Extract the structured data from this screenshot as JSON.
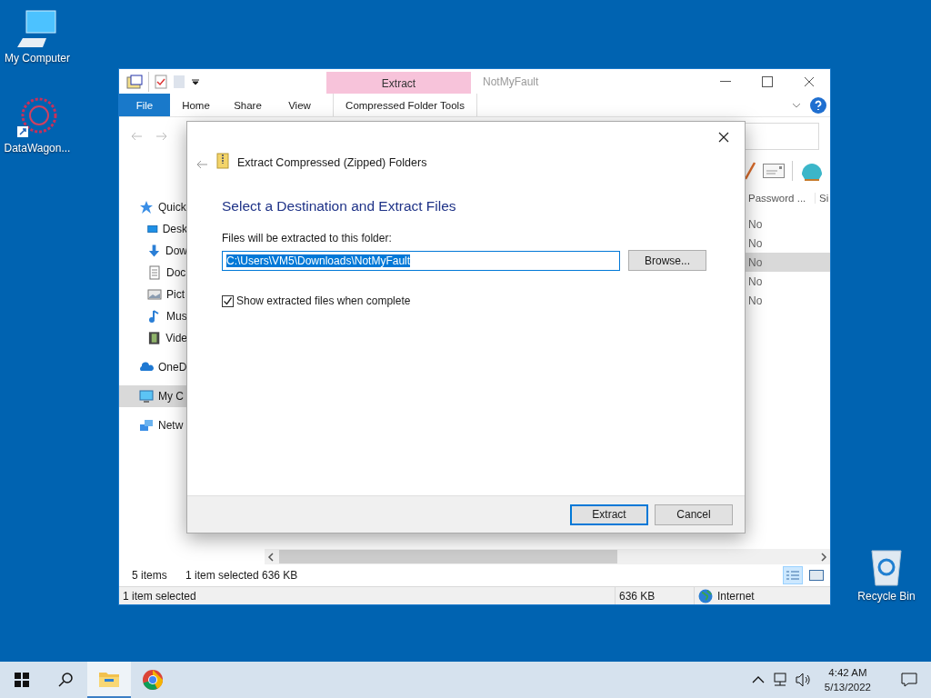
{
  "desktop_icons": [
    {
      "label": "My Computer",
      "kind": "computer"
    },
    {
      "label": "DataWagon...",
      "kind": "shortcut"
    },
    {
      "label": "Recycle Bin",
      "kind": "recycle"
    }
  ],
  "explorer": {
    "title": "NotMyFault",
    "context_tab": "Extract",
    "ribbon_tabs": [
      {
        "label": "File",
        "kind": "file"
      },
      {
        "label": "Home",
        "kind": "tab"
      },
      {
        "label": "Share",
        "kind": "tab"
      },
      {
        "label": "View",
        "kind": "tab"
      },
      {
        "label": "Compressed Folder Tools",
        "kind": "context"
      }
    ],
    "nav_pane": [
      {
        "label": "Quick",
        "kind": "star",
        "selected": false,
        "children": [
          {
            "label": "Desk",
            "kind": "desktop",
            "selected": false
          },
          {
            "label": "Dow",
            "kind": "download",
            "selected": false
          },
          {
            "label": "Doc",
            "kind": "document",
            "selected": false
          },
          {
            "label": "Pict",
            "kind": "pictures",
            "selected": false
          },
          {
            "label": "Mus",
            "kind": "music",
            "selected": false
          },
          {
            "label": "Vide",
            "kind": "video",
            "selected": false
          }
        ]
      },
      {
        "label": "OneD",
        "kind": "cloud",
        "selected": false
      },
      {
        "label": "My C",
        "kind": "computer",
        "selected": true
      },
      {
        "label": "Netw",
        "kind": "network",
        "selected": false
      }
    ],
    "columns": [
      "Password ...",
      "Si"
    ],
    "rows": [
      {
        "cells": [
          "No"
        ],
        "selected": false
      },
      {
        "cells": [
          "No"
        ],
        "selected": false
      },
      {
        "cells": [
          "No"
        ],
        "selected": true
      },
      {
        "cells": [
          "No"
        ],
        "selected": false
      },
      {
        "cells": [
          "No"
        ],
        "selected": false
      }
    ],
    "status": {
      "item_count": "5 items",
      "selection": "1 item selected",
      "size": "636 KB"
    },
    "status_bar": {
      "selection": "1 item selected",
      "size": "636 KB",
      "zone": "Internet"
    }
  },
  "dialog": {
    "title": "Extract Compressed (Zipped) Folders",
    "heading": "Select a Destination and Extract Files",
    "path_label": "Files will be extracted to this folder:",
    "path": "C:\\Users\\VM5\\Downloads\\NotMyFault",
    "browse": "Browse...",
    "show_files": {
      "label": "Show extracted files when complete",
      "checked": true
    },
    "buttons": [
      {
        "label": "Extract",
        "default": true
      },
      {
        "label": "Cancel",
        "default": false
      }
    ]
  },
  "taskbar": {
    "apps": [
      {
        "kind": "explorer",
        "active": true
      },
      {
        "kind": "chrome",
        "active": false
      }
    ],
    "time": "4:42 AM",
    "date": "5/13/2022"
  }
}
